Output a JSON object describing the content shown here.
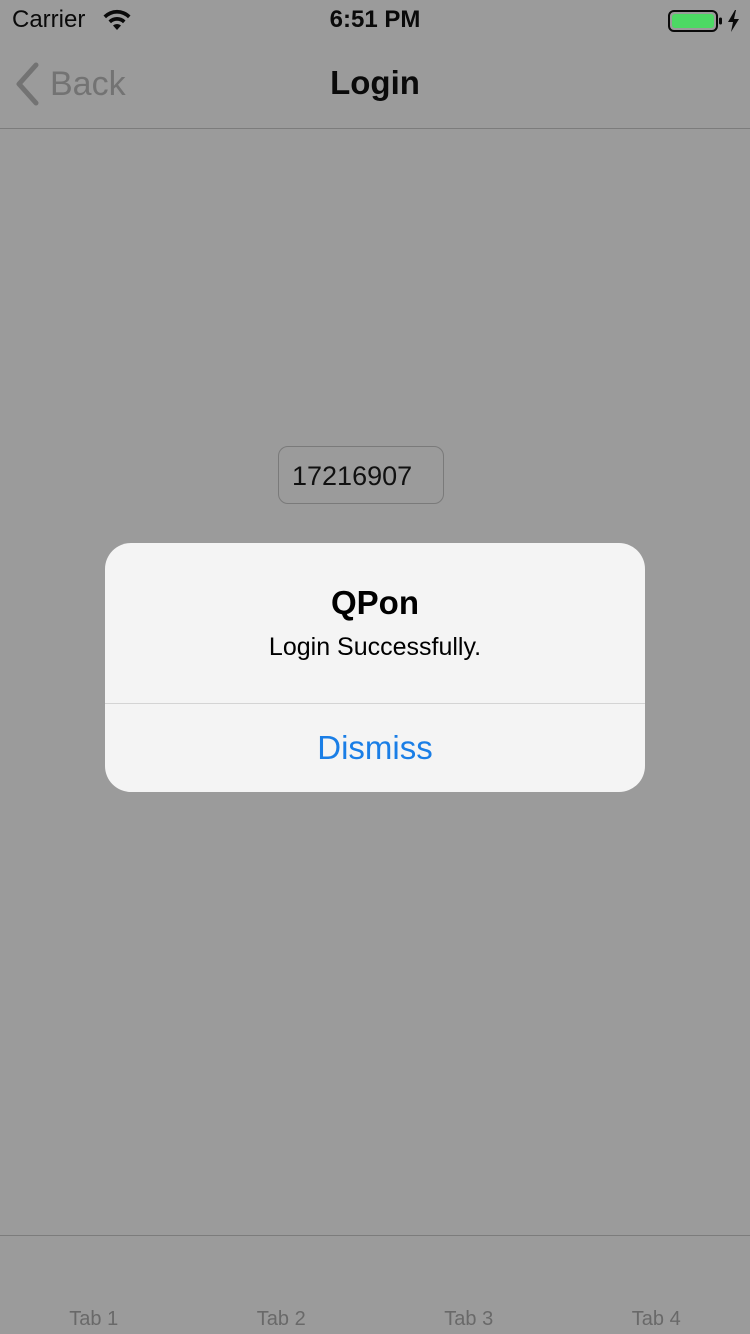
{
  "status_bar": {
    "carrier": "Carrier",
    "time": "6:51 PM",
    "wifi_icon": "wifi-icon",
    "battery_icon": "battery-charging-icon",
    "battery_color": "#4cd964"
  },
  "nav": {
    "back_label": "Back",
    "back_icon": "chevron-left-icon",
    "title": "Login"
  },
  "main": {
    "code_field_value": "17216907"
  },
  "alert": {
    "title": "QPon",
    "message": "Login Successfully.",
    "button_label": "Dismiss",
    "button_color": "#1a7ee6"
  },
  "tab_bar": {
    "tabs": [
      {
        "label": "Tab 1"
      },
      {
        "label": "Tab 2"
      },
      {
        "label": "Tab 3"
      },
      {
        "label": "Tab 4"
      }
    ]
  }
}
